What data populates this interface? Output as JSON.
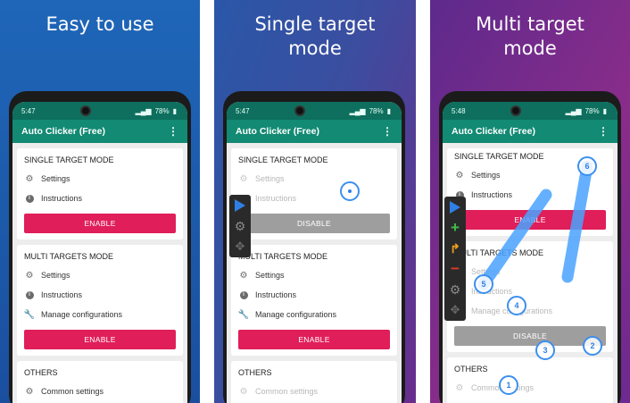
{
  "colors": {
    "enable": "#e01e5a",
    "disable": "#9e9e9e",
    "appbar": "#138a73",
    "status": "#0e6f5e",
    "target": "#3c8ff0"
  },
  "panels": [
    {
      "headline": "Easy to use",
      "status": {
        "time": "5:47",
        "battery": "78%"
      },
      "app_title": "Auto Clicker (Free)",
      "single": {
        "title": "SINGLE TARGET MODE",
        "settings": "Settings",
        "instructions": "Instructions",
        "button": "ENABLE"
      },
      "multi": {
        "title": "MULTI TARGETS MODE",
        "settings": "Settings",
        "instructions": "Instructions",
        "manage": "Manage configurations",
        "button": "ENABLE"
      },
      "others": {
        "title": "OTHERS",
        "common": "Common settings"
      }
    },
    {
      "headline": "Single target mode",
      "status": {
        "time": "5:47",
        "battery": "78%"
      },
      "app_title": "Auto Clicker (Free)",
      "single": {
        "title": "SINGLE TARGET MODE",
        "settings": "Settings",
        "instructions": "Instructions",
        "button": "DISABLE"
      },
      "multi": {
        "title": "MULTI TARGETS MODE",
        "settings": "Settings",
        "instructions": "Instructions",
        "manage": "Manage configurations",
        "button": "ENABLE"
      },
      "others": {
        "title": "OTHERS",
        "common": "Common settings"
      }
    },
    {
      "headline": "Multi target mode",
      "status": {
        "time": "5:48",
        "battery": "78%"
      },
      "app_title": "Auto Clicker (Free)",
      "single": {
        "title": "SINGLE TARGET MODE",
        "settings": "Settings",
        "instructions": "Instructions",
        "button": "ENABLE"
      },
      "multi": {
        "title": "MULTI TARGETS MODE",
        "settings": "Settings",
        "instructions": "Instructions",
        "manage": "Manage configurations",
        "button": "DISABLE"
      },
      "others": {
        "title": "OTHERS",
        "common": "Common settings"
      },
      "targets": [
        "1",
        "2",
        "3",
        "4",
        "5",
        "6"
      ]
    }
  ]
}
